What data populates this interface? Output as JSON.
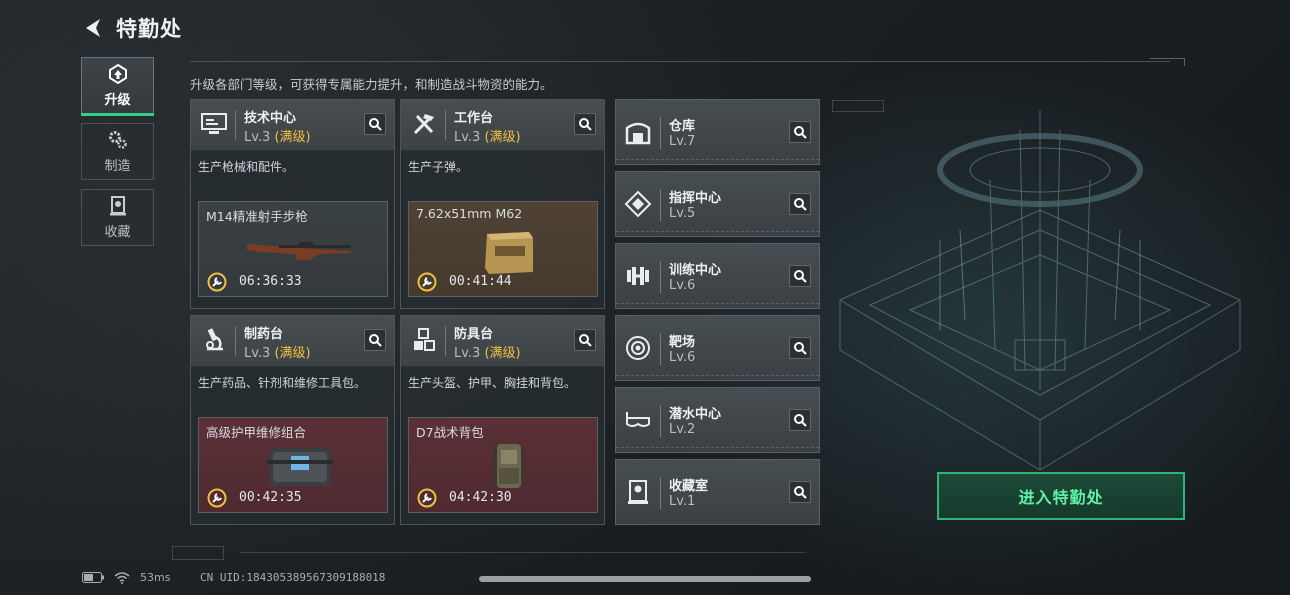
{
  "header": {
    "title": "特勤处"
  },
  "nav": [
    {
      "label": "升级",
      "icon": "upgrade-icon",
      "active": true
    },
    {
      "label": "制造",
      "icon": "gears-icon",
      "active": false
    },
    {
      "label": "收藏",
      "icon": "collection-icon",
      "active": false
    }
  ],
  "description": "升级各部门等级，可获得专属能力提升，和制造战斗物资的能力。",
  "workshops": [
    {
      "name": "技术中心",
      "level": "Lv.3",
      "max": "(满级)",
      "desc": "生产枪械和配件。",
      "product": "M14精准射手步枪",
      "timer": "06:36:33",
      "icon": "computer-icon",
      "product_bg": "grey"
    },
    {
      "name": "工作台",
      "level": "Lv.3",
      "max": "(满级)",
      "desc": "生产子弹。",
      "product": "7.62x51mm M62",
      "timer": "00:41:44",
      "icon": "tools-icon",
      "product_bg": "brown"
    },
    {
      "name": "制药台",
      "level": "Lv.3",
      "max": "(满级)",
      "desc": "生产药品、针剂和维修工具包。",
      "product": "高级护甲维修组合",
      "timer": "00:42:35",
      "icon": "microscope-icon",
      "product_bg": "red"
    },
    {
      "name": "防具台",
      "level": "Lv.3",
      "max": "(满级)",
      "desc": "生产头盔、护甲、胸挂和背包。",
      "product": "D7战术背包",
      "timer": "04:42:30",
      "icon": "cubes-icon",
      "product_bg": "red"
    }
  ],
  "facilities": [
    {
      "name": "仓库",
      "level": "Lv.7",
      "icon": "warehouse-icon"
    },
    {
      "name": "指挥中心",
      "level": "Lv.5",
      "icon": "command-icon"
    },
    {
      "name": "训练中心",
      "level": "Lv.6",
      "icon": "dumbbell-icon"
    },
    {
      "name": "靶场",
      "level": "Lv.6",
      "icon": "target-icon"
    },
    {
      "name": "潜水中心",
      "level": "Lv.2",
      "icon": "diving-mask-icon"
    },
    {
      "name": "收藏室",
      "level": "Lv.1",
      "icon": "vault-icon"
    }
  ],
  "enter_button": "进入特勤处",
  "status": {
    "ping": "53ms",
    "uid": "CN UID:1843053895673091880​18"
  },
  "colors": {
    "accent": "#35d08a",
    "max_level": "#f0c040",
    "enter_text": "#5ff2a7"
  }
}
